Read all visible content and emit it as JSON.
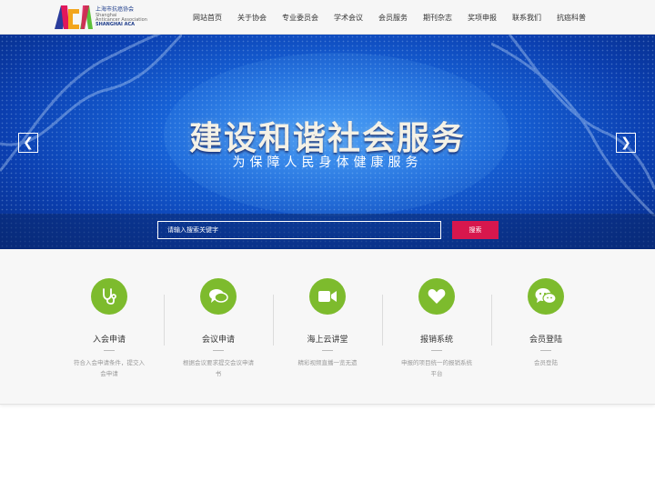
{
  "colors": {
    "accent_green": "#7dbb2d",
    "search_button": "#d7174d",
    "banner_blue": "#1763d8"
  },
  "logo": {
    "mark": "ACA",
    "name_cn": "上海市抗癌协会",
    "name_en_1": "Shanghai",
    "name_en_2": "Anticancer Association",
    "name_en_3": "SHANGHAI ACA"
  },
  "nav": {
    "items": [
      {
        "label": "网站首页"
      },
      {
        "label": "关于协会"
      },
      {
        "label": "专业委员会"
      },
      {
        "label": "学术会议"
      },
      {
        "label": "会员服务"
      },
      {
        "label": "期刊杂志"
      },
      {
        "label": "奖项申报"
      },
      {
        "label": "联系我们"
      },
      {
        "label": "抗癌科普"
      }
    ]
  },
  "banner": {
    "title": "建设和谐社会服务",
    "subtitle": "为保障人民身体健康服务",
    "prev_arrow": "❮",
    "next_arrow": "❯"
  },
  "search": {
    "placeholder": "请输入搜索关键字",
    "button_label": "搜索"
  },
  "services": [
    {
      "icon": "stethoscope-icon",
      "title": "入会申请",
      "desc": "符合入会申请条件，提交入会申请"
    },
    {
      "icon": "chat-icon",
      "title": "会议申请",
      "desc": "根据会议要求提交会议申请书"
    },
    {
      "icon": "video-camera-icon",
      "title": "海上云讲堂",
      "desc": "精彩视频直播一览无遗"
    },
    {
      "icon": "heart-icon",
      "title": "报销系统",
      "desc": "申报的项目统一的报销系统平台"
    },
    {
      "icon": "wechat-icon",
      "title": "会员登陆",
      "desc": "会员登陆"
    }
  ]
}
